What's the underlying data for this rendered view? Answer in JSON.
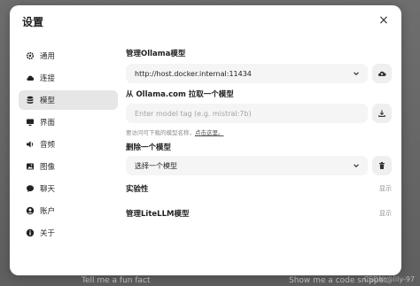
{
  "background": {
    "hint_left": "Tell me a fun fact",
    "hint_right": "Show me a code snippet"
  },
  "watermark": "CSDN @lily-97",
  "modal": {
    "title": "设置",
    "close_icon": "×"
  },
  "sidebar": {
    "items": [
      {
        "label": "通用",
        "icon": "gear-icon"
      },
      {
        "label": "连接",
        "icon": "cloud-icon"
      },
      {
        "label": "模型",
        "icon": "database-icon",
        "active": true
      },
      {
        "label": "界面",
        "icon": "monitor-icon"
      },
      {
        "label": "音频",
        "icon": "speaker-icon"
      },
      {
        "label": "图像",
        "icon": "image-icon"
      },
      {
        "label": "聊天",
        "icon": "chat-icon"
      },
      {
        "label": "账户",
        "icon": "user-icon"
      },
      {
        "label": "关于",
        "icon": "info-icon"
      }
    ]
  },
  "content": {
    "ollama_section_label": "管理Ollama模型",
    "ollama_url_value": "http://host.docker.internal:11434",
    "pull_section_label": "从 Ollama.com 拉取一个模型",
    "pull_input_placeholder": "Enter model tag (e.g. mistral:7b)",
    "pull_hint_text": "要访问可下载的模型名称，",
    "pull_hint_link": "点击这里。",
    "delete_section_label": "删除一个模型",
    "delete_select_value": "选择一个模型",
    "experimental_label": "实验性",
    "experimental_toggle": "显示",
    "litellm_label": "管理LiteLLM模型",
    "litellm_toggle": "显示"
  },
  "colors": {
    "accent": "#1f1f1f",
    "active_item_bg": "#e6e6e6",
    "field_bg": "#f5f5f5"
  }
}
